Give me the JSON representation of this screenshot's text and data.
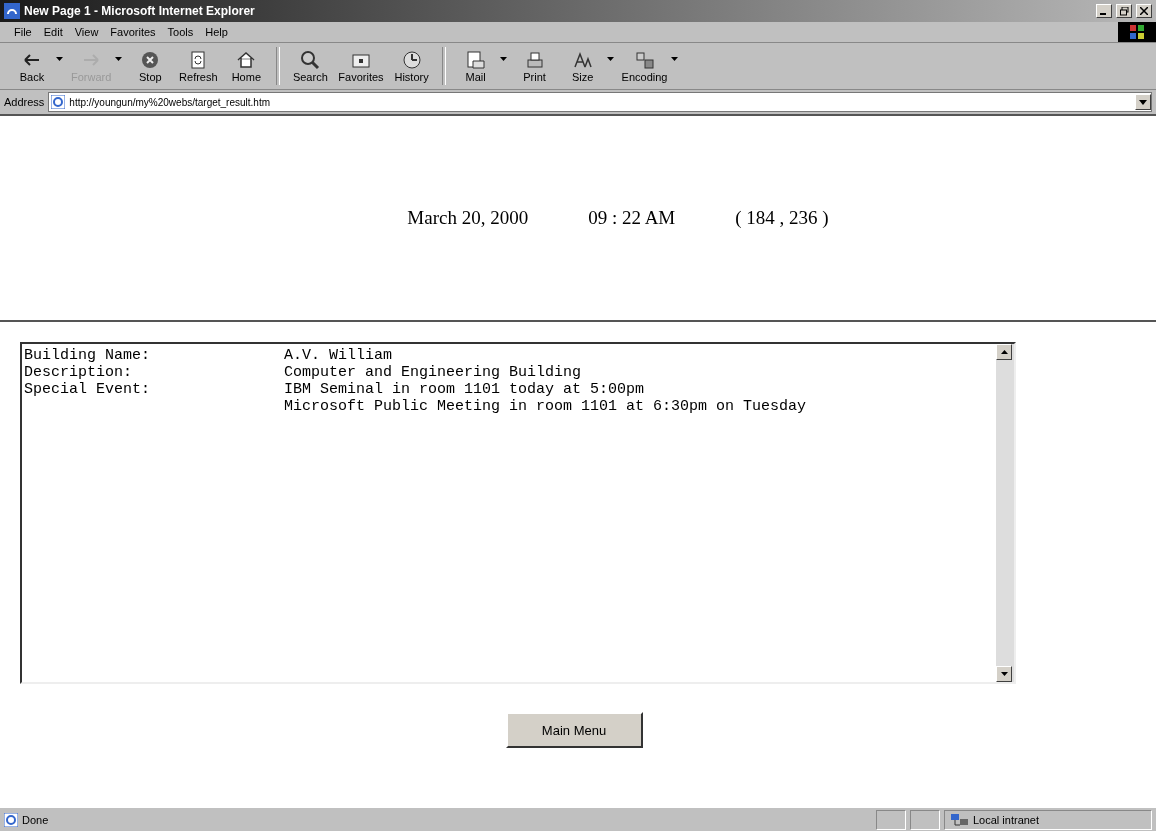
{
  "window": {
    "title": "New Page 1 - Microsoft Internet Explorer"
  },
  "menu": [
    "File",
    "Edit",
    "View",
    "Favorites",
    "Tools",
    "Help"
  ],
  "toolbar": {
    "groups": [
      [
        {
          "label": "Back",
          "disabled": false,
          "dropdown": true
        },
        {
          "label": "Forward",
          "disabled": true,
          "dropdown": true
        },
        {
          "label": "Stop",
          "disabled": false,
          "dropdown": false
        },
        {
          "label": "Refresh",
          "disabled": false,
          "dropdown": false
        },
        {
          "label": "Home",
          "disabled": false,
          "dropdown": false
        }
      ],
      [
        {
          "label": "Search",
          "disabled": false,
          "dropdown": false
        },
        {
          "label": "Favorites",
          "disabled": false,
          "dropdown": false
        },
        {
          "label": "History",
          "disabled": false,
          "dropdown": false
        }
      ],
      [
        {
          "label": "Mail",
          "disabled": false,
          "dropdown": true
        },
        {
          "label": "Print",
          "disabled": false,
          "dropdown": false
        },
        {
          "label": "Size",
          "disabled": false,
          "dropdown": true
        },
        {
          "label": "Encoding",
          "disabled": false,
          "dropdown": true
        }
      ]
    ]
  },
  "address": {
    "label": "Address",
    "value": "http://youngun/my%20webs/target_result.htm"
  },
  "header": {
    "date": "March 20, 2000",
    "time": "09 : 22 AM",
    "coordinates": "( 184 , 236 )"
  },
  "textarea": {
    "rows": [
      {
        "label": "Building Name:",
        "value": "A.V. William"
      },
      {
        "label": "Description:",
        "value": "Computer and Engineering Building"
      },
      {
        "label": "Special Event:",
        "value": "IBM Seminal in room 1101 today at 5:00pm"
      },
      {
        "value": "Microsoft Public Meeting in room 1101 at 6:30pm on Tuesday"
      }
    ]
  },
  "button": "Main Menu",
  "status_bar": {
    "text": "Done",
    "zone": "Local intranet"
  }
}
